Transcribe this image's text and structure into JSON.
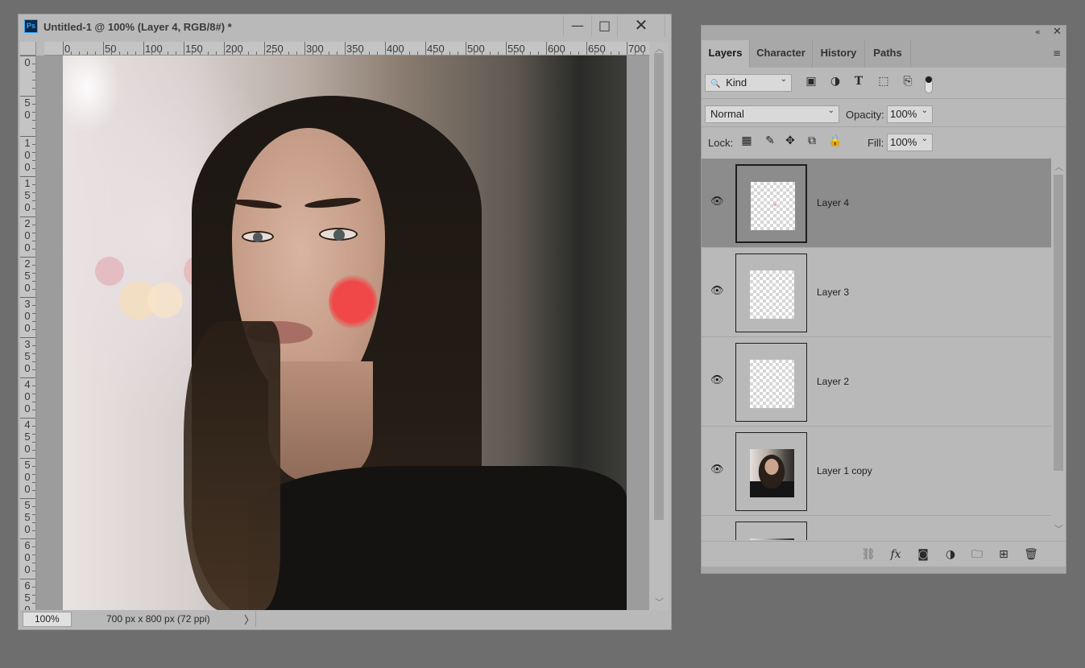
{
  "document": {
    "app_badge": "Ps",
    "title": "Untitled-1 @ 100% (Layer 4, RGB/8#) *",
    "window_controls": {
      "minimize": "—",
      "maximize": "□",
      "close": "✕"
    },
    "ruler_h": [
      "0",
      "50",
      "100",
      "150",
      "200",
      "250",
      "300",
      "350",
      "400",
      "450",
      "500",
      "550",
      "600",
      "650",
      "700"
    ],
    "ruler_v": [
      "0",
      "5\n0",
      "1\n0\n0",
      "1\n5\n0",
      "2\n0\n0",
      "2\n5\n0",
      "3\n0\n0",
      "3\n5\n0",
      "4\n0\n0",
      "4\n5\n0",
      "5\n0\n0",
      "5\n5\n0",
      "6\n0\n0",
      "6\n5\n0"
    ],
    "zoom": "100%",
    "info": "700 px x 800 px (72 ppi)",
    "status_arrow": "〉",
    "blush_color": "#f04848"
  },
  "panel": {
    "collapse_icon": "«",
    "close_icon": "✕",
    "tabs": [
      {
        "label": "Layers",
        "active": true
      },
      {
        "label": "Character",
        "active": false
      },
      {
        "label": "History",
        "active": false
      },
      {
        "label": "Paths",
        "active": false
      }
    ],
    "menu_icon": "≡",
    "filter": {
      "kind_label": "Kind",
      "search_icon": "🔍",
      "caret": "⌄"
    },
    "blend": {
      "mode": "Normal",
      "opacity_label": "Opacity:",
      "opacity": "100%"
    },
    "lock": {
      "label": "Lock:",
      "fill_label": "Fill:",
      "fill": "100%"
    },
    "layers": [
      {
        "name": "Layer 4",
        "selected": true,
        "thumb": "transparent"
      },
      {
        "name": "Layer 3",
        "selected": false,
        "thumb": "transparent"
      },
      {
        "name": "Layer 2",
        "selected": false,
        "thumb": "transparent"
      },
      {
        "name": "Layer 1 copy",
        "selected": false,
        "thumb": "photo"
      }
    ]
  }
}
